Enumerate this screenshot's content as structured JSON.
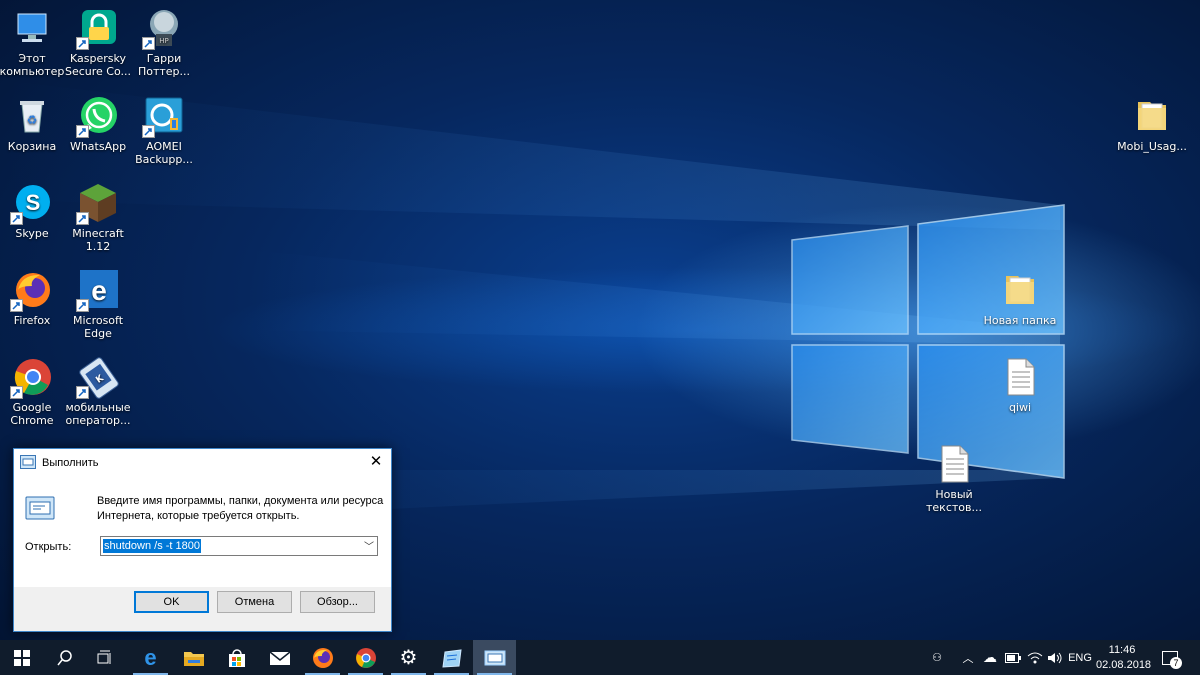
{
  "desktop": {
    "icons": [
      {
        "label": "Этот\nкомпьютер",
        "icon": "this-pc-icon"
      },
      {
        "label": "Kaspersky\nSecure Co...",
        "icon": "kaspersky-icon"
      },
      {
        "label": "Гарри\nПоттер...",
        "icon": "harry-potter-game-icon"
      },
      {
        "label": "Корзина",
        "icon": "recycle-bin-icon"
      },
      {
        "label": "WhatsApp",
        "icon": "whatsapp-icon"
      },
      {
        "label": "AOMEI\nBackupp...",
        "icon": "aomei-backupper-icon"
      },
      {
        "label": "Skype",
        "icon": "skype-icon"
      },
      {
        "label": "Minecraft\n1.12",
        "icon": "minecraft-icon"
      },
      {
        "label": "Firefox",
        "icon": "firefox-icon"
      },
      {
        "label": "Microsoft\nEdge",
        "icon": "edge-icon"
      },
      {
        "label": "Google\nChrome",
        "icon": "chrome-icon"
      },
      {
        "label": "мобильные\nоператор...",
        "icon": "mobile-operators-icon"
      },
      {
        "label": "Mobi_Usag...",
        "icon": "folder-icon"
      },
      {
        "label": "Новая папка",
        "icon": "folder-icon"
      },
      {
        "label": "qiwi",
        "icon": "text-file-icon"
      },
      {
        "label": "Новый\nтекстов...",
        "icon": "text-file-icon"
      }
    ]
  },
  "run_dialog": {
    "title": "Выполнить",
    "message": "Введите имя программы, папки, документа или ресурса Интернета, которые требуется открыть.",
    "open_label": "Открыть:",
    "input_value": "shutdown /s -t 1800",
    "ok_label": "OK",
    "cancel_label": "Отмена",
    "browse_label": "Обзор..."
  },
  "taskbar": {
    "items": [
      "start-icon",
      "search-icon",
      "task-view-icon",
      "edge-icon",
      "file-explorer-icon",
      "store-icon",
      "mail-icon",
      "firefox-icon",
      "chrome-icon",
      "settings-icon",
      "notepad-icon",
      "run-icon"
    ],
    "tray": {
      "language": "ENG",
      "time": "11:46",
      "date": "02.08.2018",
      "notification_count": "7"
    }
  },
  "colors": {
    "accent": "#0078d7",
    "taskbar": "#101c2c",
    "desktop": "#06275e"
  }
}
